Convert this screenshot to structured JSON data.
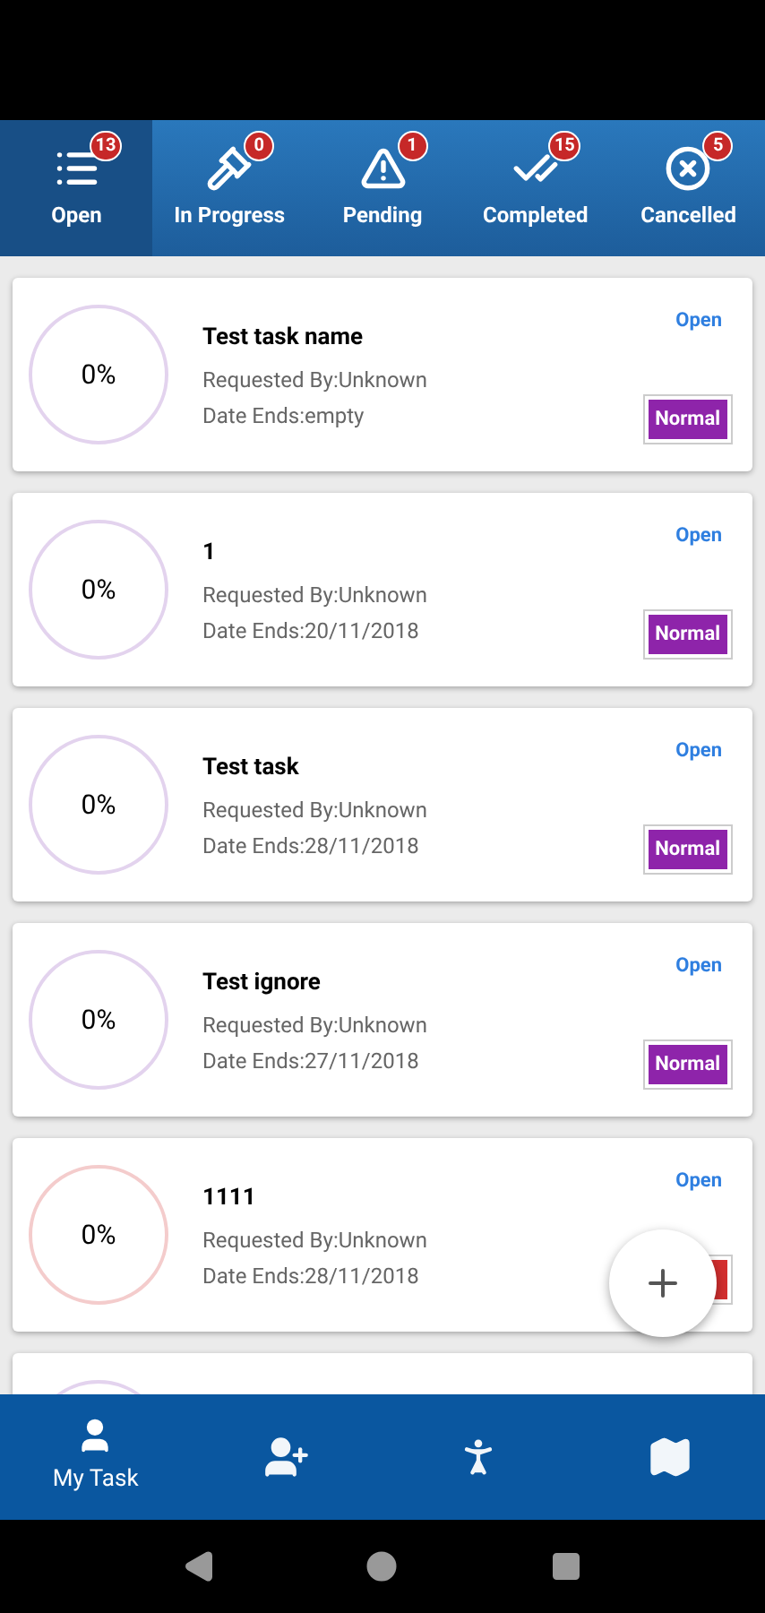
{
  "tabs": [
    {
      "kind": "list",
      "label": "Open",
      "count": "13",
      "selected": true
    },
    {
      "kind": "gavel",
      "label": "In Progress",
      "count": "0",
      "selected": false
    },
    {
      "kind": "warning",
      "label": "Pending",
      "count": "1",
      "selected": false
    },
    {
      "kind": "done",
      "label": "Completed",
      "count": "15",
      "selected": false
    },
    {
      "kind": "cancel",
      "label": "Cancelled",
      "count": "5",
      "selected": false
    }
  ],
  "tasks": [
    {
      "progress": "0%",
      "color": "#e3d3ee",
      "name": "Test task name",
      "requested_by": "Requested By:Unknown",
      "date_ends": "Date Ends:empty",
      "status": "Open",
      "priority": {
        "label": "Normal",
        "color": "#8e24aa"
      }
    },
    {
      "progress": "0%",
      "color": "#e3d3ee",
      "name": "1",
      "requested_by": "Requested By:Unknown",
      "date_ends": "Date Ends:20/11/2018",
      "status": "Open",
      "priority": {
        "label": "Normal",
        "color": "#8e24aa"
      }
    },
    {
      "progress": "0%",
      "color": "#e3d3ee",
      "name": "Test task",
      "requested_by": "Requested By:Unknown",
      "date_ends": "Date Ends:28/11/2018",
      "status": "Open",
      "priority": {
        "label": "Normal",
        "color": "#8e24aa"
      }
    },
    {
      "progress": "0%",
      "color": "#e3d3ee",
      "name": "Test ignore",
      "requested_by": "Requested By:Unknown",
      "date_ends": "Date Ends:27/11/2018",
      "status": "Open",
      "priority": {
        "label": "Normal",
        "color": "#8e24aa"
      }
    },
    {
      "progress": "0%",
      "color": "#f4cccc",
      "name": "1111",
      "requested_by": "Requested By:Unknown",
      "date_ends": "Date Ends:28/11/2018",
      "status": "Open",
      "priority": {
        "color": "#d32f2f"
      }
    },
    {
      "color": "#e3d3ee"
    }
  ],
  "bottom_nav": [
    {
      "kind": "user",
      "label": "My Task",
      "selected": true
    },
    {
      "kind": "add-user",
      "selected": false
    },
    {
      "kind": "person",
      "selected": false
    },
    {
      "kind": "map",
      "selected": false
    }
  ]
}
